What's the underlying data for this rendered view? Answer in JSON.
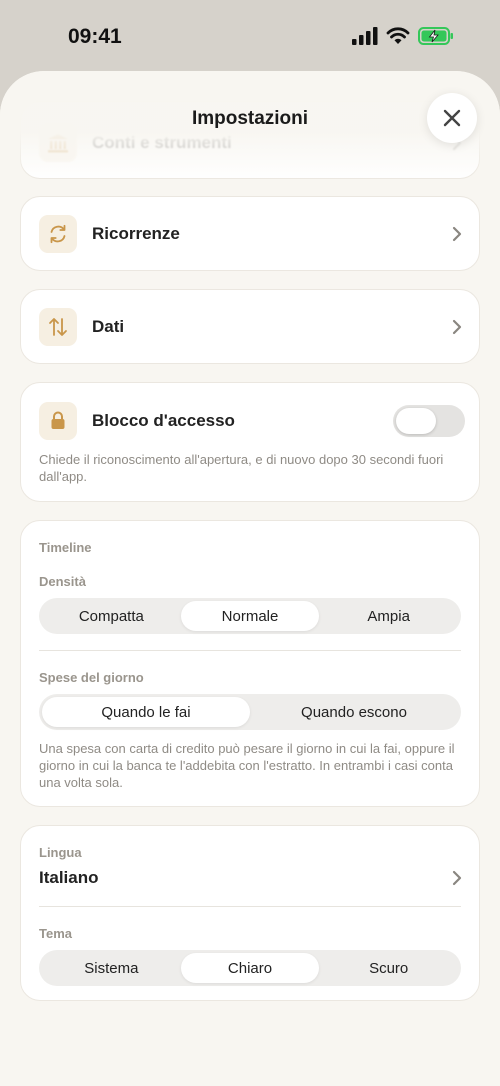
{
  "status_bar": {
    "time": "09:41"
  },
  "header": {
    "title": "Impostazioni"
  },
  "menu": {
    "accounts_label": "Conti e strumenti",
    "recurring_label": "Ricorrenze",
    "data_label": "Dati"
  },
  "lock": {
    "label": "Blocco d'accesso",
    "enabled": false,
    "description": "Chiede il riconoscimento all'apertura, e di nuovo dopo 30 secondi fuori dall'app."
  },
  "timeline": {
    "section_title": "Timeline",
    "density": {
      "label": "Densità",
      "options": [
        "Compatta",
        "Normale",
        "Ampia"
      ],
      "selected": "Normale"
    },
    "day_expenses": {
      "label": "Spese del giorno",
      "options": [
        "Quando le fai",
        "Quando escono"
      ],
      "selected": "Quando le fai",
      "description": "Una spesa con carta di credito può pesare il giorno in cui la fai, oppure il giorno in cui la banca te l'addebita con l'estratto. In entrambi i casi conta una volta sola."
    }
  },
  "language": {
    "label": "Lingua",
    "value": "Italiano"
  },
  "theme": {
    "label": "Tema",
    "options": [
      "Sistema",
      "Chiaro",
      "Scuro"
    ],
    "selected": "Chiaro"
  },
  "colors": {
    "accent": "#c9964a",
    "icon_bg": "#f6efe2",
    "battery": "#34c759"
  }
}
